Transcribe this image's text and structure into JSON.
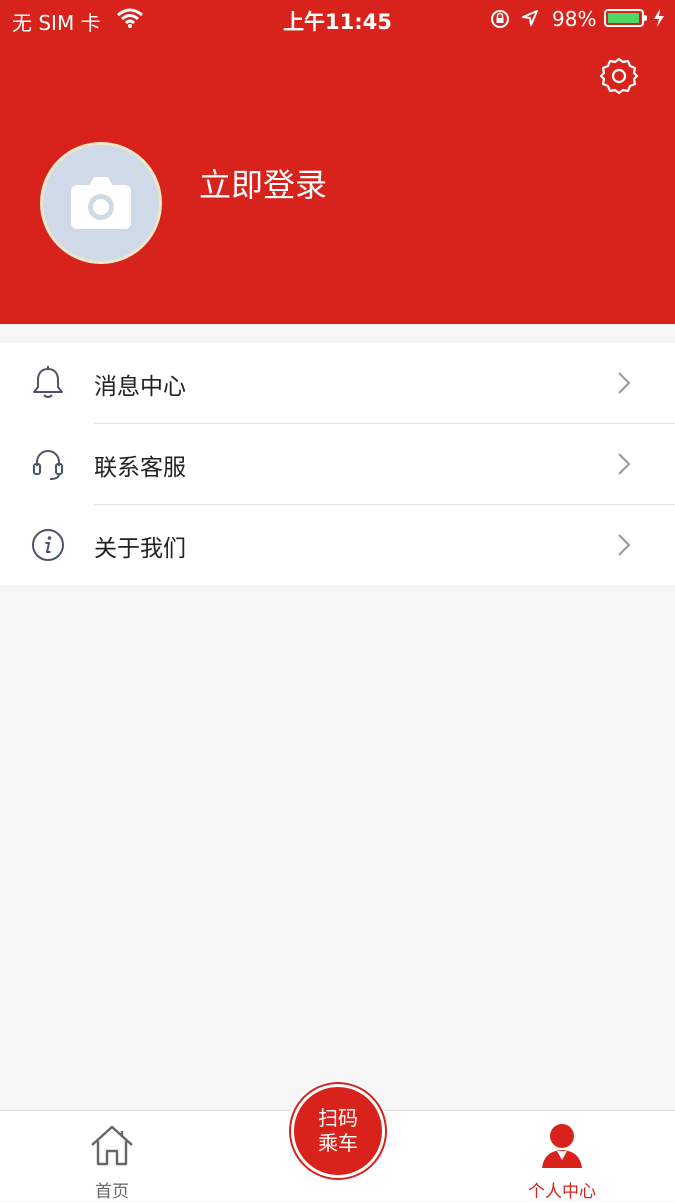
{
  "status_bar": {
    "carrier": "无 SIM 卡",
    "time": "上午11:45",
    "battery_percent": "98%",
    "battery_level": 0.98,
    "battery_color": "#4cd964"
  },
  "header": {
    "background_color": "#d8231c",
    "login_label": "立即登录",
    "settings_icon": "gear-icon",
    "avatar_icon": "camera-icon"
  },
  "menu": {
    "items": [
      {
        "label": "消息中心",
        "icon": "bell-icon"
      },
      {
        "label": "联系客服",
        "icon": "headset-icon"
      },
      {
        "label": "关于我们",
        "icon": "info-icon"
      }
    ]
  },
  "tabbar": {
    "home_label": "首页",
    "scan_line1": "扫码",
    "scan_line2": "乘车",
    "me_label": "个人中心",
    "active_color": "#d8231c"
  }
}
